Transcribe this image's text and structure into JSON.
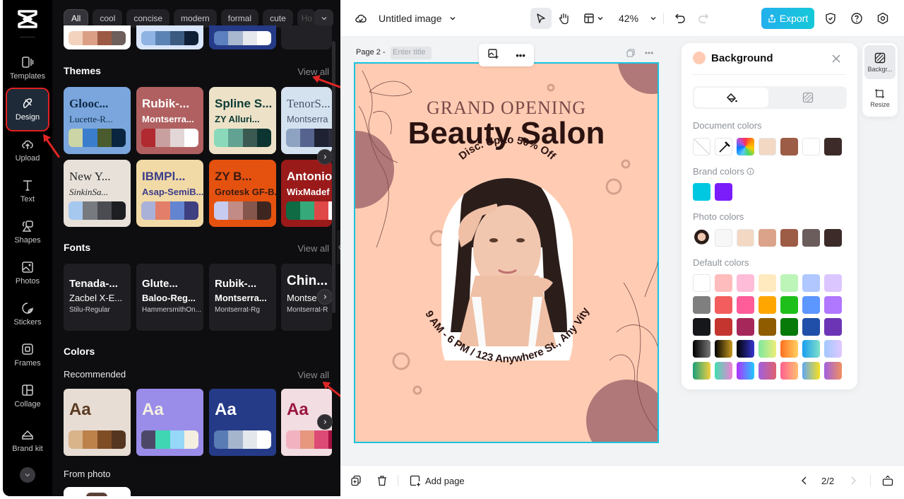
{
  "rail": {
    "items": [
      {
        "label": "Templates",
        "icon": "templates-icon"
      },
      {
        "label": "Design",
        "icon": "design-icon",
        "active": true
      },
      {
        "label": "Upload",
        "icon": "upload-icon"
      },
      {
        "label": "Text",
        "icon": "text-icon"
      },
      {
        "label": "Shapes",
        "icon": "shapes-icon"
      },
      {
        "label": "Photos",
        "icon": "photos-icon"
      },
      {
        "label": "Stickers",
        "icon": "stickers-icon"
      },
      {
        "label": "Frames",
        "icon": "frames-icon"
      },
      {
        "label": "Collage",
        "icon": "collage-icon"
      },
      {
        "label": "Brand kit",
        "icon": "brand-kit-icon"
      }
    ]
  },
  "panel": {
    "chips": [
      "All",
      "cool",
      "concise",
      "modern",
      "formal",
      "cute",
      "Ho"
    ],
    "top_swatches": [
      [
        "#f3d3bd",
        "#dba085",
        "#9c5a45",
        "#6e5e5c"
      ],
      [
        "#8fb4e3",
        "#5b83b3",
        "#3a5a80",
        "#0f1f35"
      ],
      [
        "#5c7fbf",
        "#a9b7cf",
        "#e5e8ec",
        "#ffffff"
      ]
    ],
    "themes": {
      "title": "Themes",
      "view_all": "View all",
      "cards": [
        {
          "t1": "Glooc...",
          "t2": "Lucette-R...",
          "bg": "#7aa6dd",
          "fg": "#0f2a48",
          "swatches": [
            "#ccd5a6",
            "#3a7dcd",
            "#4a5b2e",
            "#0a2540"
          ]
        },
        {
          "t1": "Rubik-...",
          "t2": "Montserra...",
          "bg": "#b06060",
          "fg": "#ffffff",
          "swatches": [
            "#b02a30",
            "#c9a0a0",
            "#e3d6d6",
            "#ffffff"
          ]
        },
        {
          "t1": "Spline S...",
          "t2": "ZY Alluri...",
          "bg": "#ede2c7",
          "fg": "#0e3b36",
          "swatches": [
            "#8ad9bb",
            "#62a292",
            "#3b5a52",
            "#0c3531"
          ]
        },
        {
          "t1": "TenorS...",
          "t2": "Montserra",
          "bg": "#d4e1ef",
          "fg": "#4a5470",
          "swatches": [
            "#8ea3c2",
            "#56638f",
            "#1f2233",
            "#2a2c3c"
          ]
        },
        {
          "t1": "New Y...",
          "t2": "SinkinSa...",
          "bg": "#e7e1da",
          "fg": "#2a2a2a",
          "swatches": [
            "#a6c8ef",
            "#777b80",
            "#4a4c52",
            "#1c1e22"
          ]
        },
        {
          "t1": "IBMPl...",
          "t2": "Asap-SemiB...",
          "bg": "#f1daa6",
          "fg": "#3c3d8a",
          "swatches": [
            "#aab1d8",
            "#e37e6a",
            "#6384d0",
            "#3d3f80"
          ]
        },
        {
          "t1": "ZY B...",
          "t2": "Grotesk GF-B...",
          "bg": "#e5520f",
          "fg": "#3a1a10",
          "swatches": [
            "#c7cbef",
            "#c28b85",
            "#85564b",
            "#3d2620"
          ]
        },
        {
          "t1": "Antonio-B",
          "t2": "WixMadef",
          "bg": "#9a1a1a",
          "fg": "#ffffff",
          "swatches": [
            "#0f6b44",
            "#35a97a",
            "#e04848",
            "#ffffff"
          ]
        }
      ]
    },
    "fonts": {
      "title": "Fonts",
      "view_all": "View all",
      "cards": [
        {
          "a": "Tenada-...",
          "b": "Zacbel X-E...",
          "c": "Stilu-Regular"
        },
        {
          "a": "Glute...",
          "b": "Baloo-Reg...",
          "c": "HammersmithOn..."
        },
        {
          "a": "Rubik-...",
          "b": "Montserra...",
          "c": "Montserrat-Rg"
        },
        {
          "a": "Chin...",
          "b": "Montse",
          "c": "Montserrat-R"
        }
      ]
    },
    "colors": {
      "title": "Colors",
      "recommended": "Recommended",
      "view_all": "View all",
      "cards": [
        {
          "aa": "Aa",
          "bg": "#e7ddd4",
          "fg": "#5a3a22",
          "swatches": [
            "#d9b48a",
            "#bd814a",
            "#7f4d25",
            "#55351f"
          ]
        },
        {
          "aa": "Aa",
          "bg": "#9a8de9",
          "fg": "#f4efe0",
          "swatches": [
            "#4d4868",
            "#3fd6b3",
            "#96d8f8",
            "#f4efe0"
          ]
        },
        {
          "aa": "Aa",
          "bg": "#253b88",
          "fg": "#ffffff",
          "swatches": [
            "#5a7cb5",
            "#a5b5cc",
            "#e4e8ed",
            "#ffffff"
          ]
        },
        {
          "aa": "Aa",
          "bg": "#f2dde2",
          "fg": "#9a1740",
          "swatches": [
            "#f3b2c0",
            "#e6977e",
            "#dd4a75",
            "#a31040"
          ]
        }
      ],
      "from_photo": "From photo"
    }
  },
  "topbar": {
    "doc_title": "Untitled image",
    "zoom": "42%",
    "export_label": "Export"
  },
  "page": {
    "label": "Page 2 -",
    "title_placeholder": "Enter title"
  },
  "poster": {
    "line1": "GRAND OPENING",
    "line2": "Beauty Salon",
    "arc_top": "Disc. Up to 50% Off",
    "arc_bottom": "9 AM - 6 PM / 123 Anywhere St., Any Vity",
    "bg": "#ffccb3",
    "accent": "#b07878"
  },
  "bgpanel": {
    "title": "Background",
    "document_colors_label": "Document colors",
    "document_colors": [
      "none",
      "eyedropper",
      "rainbow",
      "#f3d9c4",
      "#9c5c45",
      "#ffffff",
      "#3c2b29"
    ],
    "brand_colors_label": "Brand colors",
    "brand_colors": [
      "#00c8e0",
      "#7b1cfa"
    ],
    "photo_colors_label": "Photo colors",
    "photo_colors": [
      "photo",
      "#f7f7f8",
      "#f3d9c4",
      "#dba48a",
      "#9c5c45",
      "#6b5d5c",
      "#3c2b29"
    ],
    "default_colors_label": "Default colors",
    "default_colors": [
      [
        "#ffffff",
        "#ffbcbc",
        "#ffbcd8",
        "#ffeac0",
        "#bdf5b8",
        "#b0c8ff",
        "#dcc6ff"
      ],
      [
        "#7f7f7f",
        "#f45d5d",
        "#ff5c9a",
        "#ffa600",
        "#1fbf1b",
        "#5c96ff",
        "#b077ff"
      ],
      [
        "#16171b",
        "#c4352f",
        "#a6285a",
        "#8f5d00",
        "#077a0a",
        "#1f4fa8",
        "#6c35b5"
      ],
      [
        "linear-gradient(90deg,#000,#777)",
        "linear-gradient(90deg,#000,#c99a20)",
        "linear-gradient(90deg,#000,#3535d0)",
        "linear-gradient(90deg,#7ee8a0,#eded78)",
        "linear-gradient(90deg,#ff7020,#ffd060)",
        "linear-gradient(90deg,#1a9ef0,#80e0c8)",
        "linear-gradient(90deg,#a0c8ff,#e0c8ff)"
      ],
      [
        "linear-gradient(90deg,#1a9f7a,#f5d040)",
        "linear-gradient(90deg,#40e0b0,#f080d8)",
        "linear-gradient(90deg,#b030ff,#20c8ff)",
        "linear-gradient(90deg,#a060e0,#e06070)",
        "linear-gradient(90deg,#ff6090,#ffc070)",
        "linear-gradient(90deg,#60a8f0,#f8e020)",
        "linear-gradient(90deg,#a060e0,#f09060)"
      ]
    ]
  },
  "sidetools": {
    "background_label": "Backgr...",
    "resize_label": "Resize"
  },
  "bottombar": {
    "add_page": "Add page",
    "page_counter": "2/2"
  }
}
